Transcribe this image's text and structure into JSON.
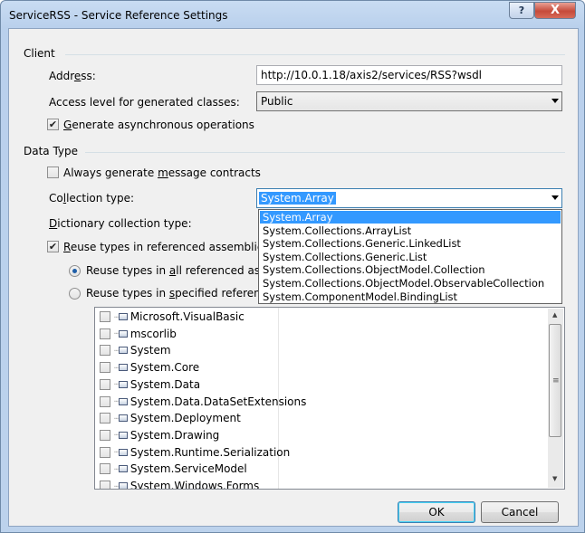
{
  "window": {
    "title": "ServiceRSS - Service Reference Settings",
    "help_glyph": "?",
    "close_glyph": "X"
  },
  "client_group": {
    "header": "Client",
    "address_label_pre": "Addr",
    "address_label_key": "e",
    "address_label_post": "ss:",
    "address_value": "http://10.0.1.18/axis2/services/RSS?wsdl",
    "access_label": "Access level for generated classes:",
    "access_value": "Public",
    "async_checked": true,
    "async_label_key": "G",
    "async_label_post": "enerate asynchronous operations"
  },
  "data_type_group": {
    "header": "Data Type",
    "always_checked": false,
    "always_label_pre": "Always generate ",
    "always_label_key": "m",
    "always_label_post": "essage contracts",
    "collection_label_pre": "Co",
    "collection_label_key": "l",
    "collection_label_post": "lection type:",
    "collection_value": "System.Array",
    "dictionary_label_key": "D",
    "dictionary_label_post": "ictionary collection type:",
    "reuse_checked": true,
    "reuse_label_key": "R",
    "reuse_label_post": "euse types in referenced assemblies",
    "reuse_all_label_pre": "Reuse types in ",
    "reuse_all_label_key": "a",
    "reuse_all_label_post": "ll referenced assemb",
    "reuse_all_selected": true,
    "reuse_specified_label_pre": "Reuse types in ",
    "reuse_specified_label_key": "s",
    "reuse_specified_label_post": "pecified referenced a",
    "reuse_specified_selected": false
  },
  "collection_dropdown": {
    "options": [
      "System.Array",
      "System.Collections.ArrayList",
      "System.Collections.Generic.LinkedList",
      "System.Collections.Generic.List",
      "System.Collections.ObjectModel.Collection",
      "System.Collections.ObjectModel.ObservableCollection",
      "System.ComponentModel.BindingList"
    ],
    "highlighted_index": 0
  },
  "assemblies": [
    "Microsoft.VisualBasic",
    "mscorlib",
    "System",
    "System.Core",
    "System.Data",
    "System.Data.DataSetExtensions",
    "System.Deployment",
    "System.Drawing",
    "System.Runtime.Serialization",
    "System.ServiceModel",
    "System.Windows.Forms"
  ],
  "buttons": {
    "ok": "OK",
    "cancel": "Cancel"
  },
  "icons": {
    "checkmark": "✔",
    "scroll_up": "▲",
    "scroll_down": "▼",
    "grip": "≡",
    "connector": "┄"
  }
}
